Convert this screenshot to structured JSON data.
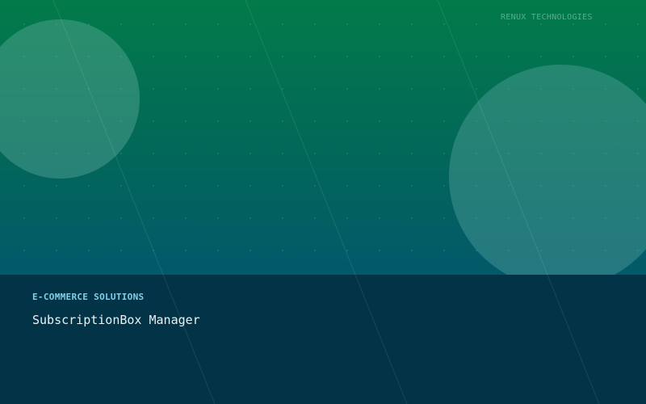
{
  "brand": {
    "company_name": "RENUX TECHNOLOGIES"
  },
  "caption": {
    "category": "E-COMMERCE SOLUTIONS",
    "product_name": "SubscriptionBox Manager"
  },
  "colors": {
    "hero_top": "#027a4a",
    "hero_bottom": "#02596a",
    "footer_panel": "#023346",
    "category_text": "#7fd0e8",
    "title_text": "#e8f2f4"
  }
}
